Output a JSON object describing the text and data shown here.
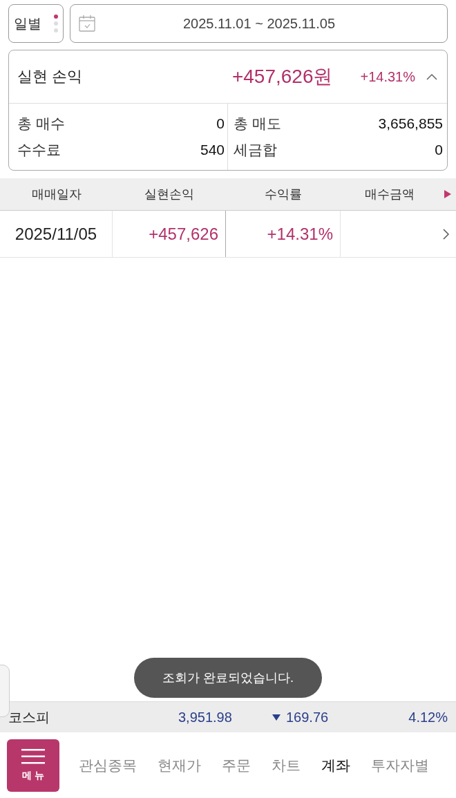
{
  "period_selector": {
    "label": "일별",
    "dots": [
      {
        "selected": true
      },
      {
        "selected": false
      },
      {
        "selected": false
      }
    ]
  },
  "date_range": {
    "value": "2025.11.01 ~ 2025.11.05"
  },
  "summary": {
    "title": "실현 손익",
    "amount": "+457,626원",
    "rate": "+14.31%",
    "expanded": true,
    "stats": [
      {
        "label": "총 매수",
        "value": "0"
      },
      {
        "label": "총 매도",
        "value": "3,656,855"
      },
      {
        "label": "수수료",
        "value": "540"
      },
      {
        "label": "세금합",
        "value": "0"
      }
    ]
  },
  "table": {
    "columns": [
      "매매일자",
      "실현손익",
      "수익률",
      "매수금액"
    ],
    "rows": [
      {
        "cells": [
          "2025/11/05",
          "+457,626",
          "+14.31%",
          ""
        ]
      }
    ]
  },
  "ticker": {
    "name": "코스피",
    "price": "3,951.98",
    "change": "169.76",
    "falling": true,
    "rate": "4.12%"
  },
  "toast": "조회가 완료되었습니다.",
  "bottom_nav": {
    "menu_label": "메 뉴",
    "items": [
      {
        "label": "관심종목",
        "selected": false
      },
      {
        "label": "현재가",
        "selected": false
      },
      {
        "label": "주문",
        "selected": false
      },
      {
        "label": "차트",
        "selected": false
      },
      {
        "label": "계좌",
        "selected": true
      },
      {
        "label": "투자자별",
        "selected": false
      }
    ]
  }
}
